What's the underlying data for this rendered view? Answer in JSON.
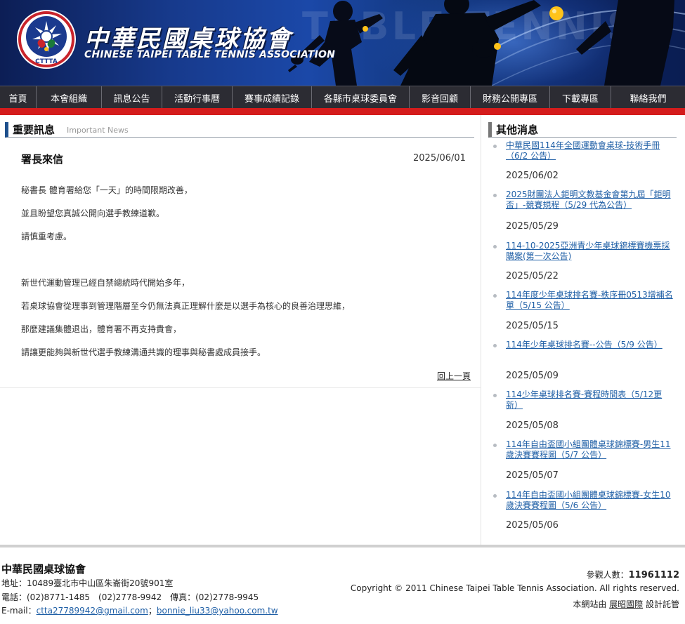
{
  "header": {
    "logo_text": "CTTTA",
    "title": "中華民國桌球協會",
    "subtitle": "CHINESE TAIPEI TABLE TENNIS ASSOCIATION",
    "banner_bg_text": "TABLE TENNIS"
  },
  "nav": {
    "items": [
      {
        "label": "首頁"
      },
      {
        "label": "本會組織"
      },
      {
        "label": "訊息公告"
      },
      {
        "label": "活動行事曆"
      },
      {
        "label": "賽事成績記錄"
      },
      {
        "label": "各縣市桌球委員會"
      },
      {
        "label": "影音回顧"
      },
      {
        "label": "財務公開專區"
      },
      {
        "label": "下載專區"
      },
      {
        "label": "聯絡我們"
      }
    ]
  },
  "main": {
    "section_title": "重要訊息",
    "section_subtitle": "Important News",
    "article": {
      "title": "署長來信",
      "date": "2025/06/01",
      "paragraphs": [
        "秘書長 體育署給您「一天」的時間限期改善，",
        "並且盼望您真誠公開向選手教練道歉。",
        "請慎重考慮。",
        "新世代運動管理已經自禁總統時代開始多年，",
        "若桌球協會從理事到管理階層至今仍無法真正理解什麼是以選手為核心的良善治理思維，",
        "那麼建議集體退出，體育署不再支持貴會，",
        "請讓更能夠與新世代選手教練溝通共識的理事與秘書處成員接手。"
      ]
    },
    "back_label": "回上一頁"
  },
  "sidebar": {
    "title": "其他消息",
    "items": [
      {
        "title": "中華民國114年全國運動會桌球-技術手冊（6/2 公告）",
        "date": "2025/06/02"
      },
      {
        "title": "2025財團法人鉅明文教基金會第九屆「鉅明盃」-競賽規程（5/29 代為公告）",
        "date": "2025/05/29"
      },
      {
        "title": "114-10-2025亞洲青少年桌球錦標賽機票採購案(第一次公告)",
        "date": "2025/05/22"
      },
      {
        "title": "114年度少年桌球排名賽-秩序冊0513增補名單（5/15 公告）",
        "date": "2025/05/15"
      },
      {
        "title": "114年少年桌球排名賽--公告（5/9 公告）",
        "date": "2025/05/09"
      },
      {
        "title": "114少年桌球排名賽-賽程時間表（5/12更新）",
        "date": "2025/05/08"
      },
      {
        "title": "114年自由盃國小組團體桌球錦標賽-男生11歲決賽賽程圖（5/7 公告）",
        "date": "2025/05/07"
      },
      {
        "title": "114年自由盃國小組團體桌球錦標賽-女生10歲決賽賽程圖（5/6 公告）",
        "date": "2025/05/06"
      }
    ]
  },
  "footer": {
    "org_name": "中華民國桌球協會",
    "address": "地址：10489臺北市中山區朱崙街20號901室",
    "phone": "電話：(02)8771-1485　(02)2778-9942　傳真：(02)2778-9945",
    "email_label": "E-mail：",
    "email1": "ctta27789942@gmail.com",
    "email_sep": "；",
    "email2": "bonnie_liu33@yahoo.com.tw",
    "visitors_label": "參觀人數：",
    "visitors_count": "11961112",
    "copyright": "Copyright © 2011 Chinese Taipei Table Tennis Association. All rights reserved.",
    "design_prefix": "本網站由 ",
    "design_link": "展昭國際",
    "design_suffix": " 設計託管"
  },
  "colors": {
    "nav_bg": "#2c2c33",
    "red_bar": "#d41c1c",
    "link": "#1f5fa6",
    "section_marker": "#1d4f8c"
  }
}
